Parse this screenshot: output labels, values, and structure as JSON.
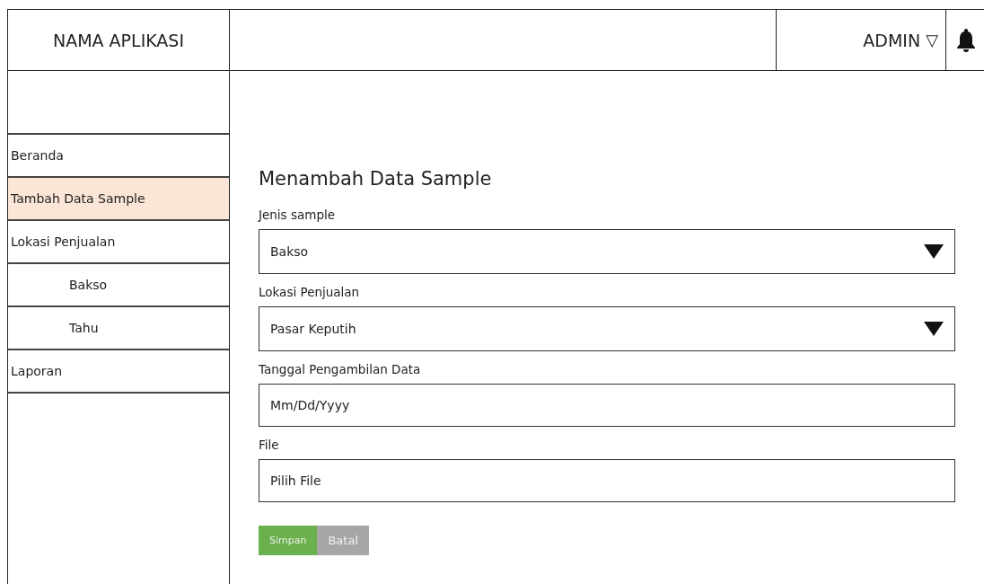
{
  "header": {
    "app_name": "NAMA APLIKASI",
    "user": "ADMIN",
    "user_caret": "▽"
  },
  "sidebar": {
    "items": [
      {
        "label": "Beranda",
        "selected": false
      },
      {
        "label": "Tambah Data Sample",
        "selected": true
      },
      {
        "label": "Lokasi Penjualan",
        "selected": false,
        "children": [
          {
            "label": "Bakso",
            "selected": false
          },
          {
            "label": "Tahu",
            "selected": false
          }
        ]
      },
      {
        "label": "Laporan",
        "selected": false
      }
    ]
  },
  "form": {
    "title": "Menambah Data Sample",
    "fields": [
      {
        "label": "Jenis sample",
        "kind": "select",
        "value": "Bakso"
      },
      {
        "label": "Lokasi Penjualan",
        "kind": "select",
        "value": "Pasar Keputih"
      },
      {
        "label": "Tanggal Pengambilan Data",
        "kind": "input",
        "placeholder": "Mm/Dd/Yyyy"
      },
      {
        "label": "File",
        "kind": "input",
        "placeholder": "Pilih File"
      }
    ],
    "buttons": [
      {
        "label": "Simpan",
        "kind": "primary"
      },
      {
        "label": "Batal",
        "kind": "secondary"
      }
    ]
  }
}
